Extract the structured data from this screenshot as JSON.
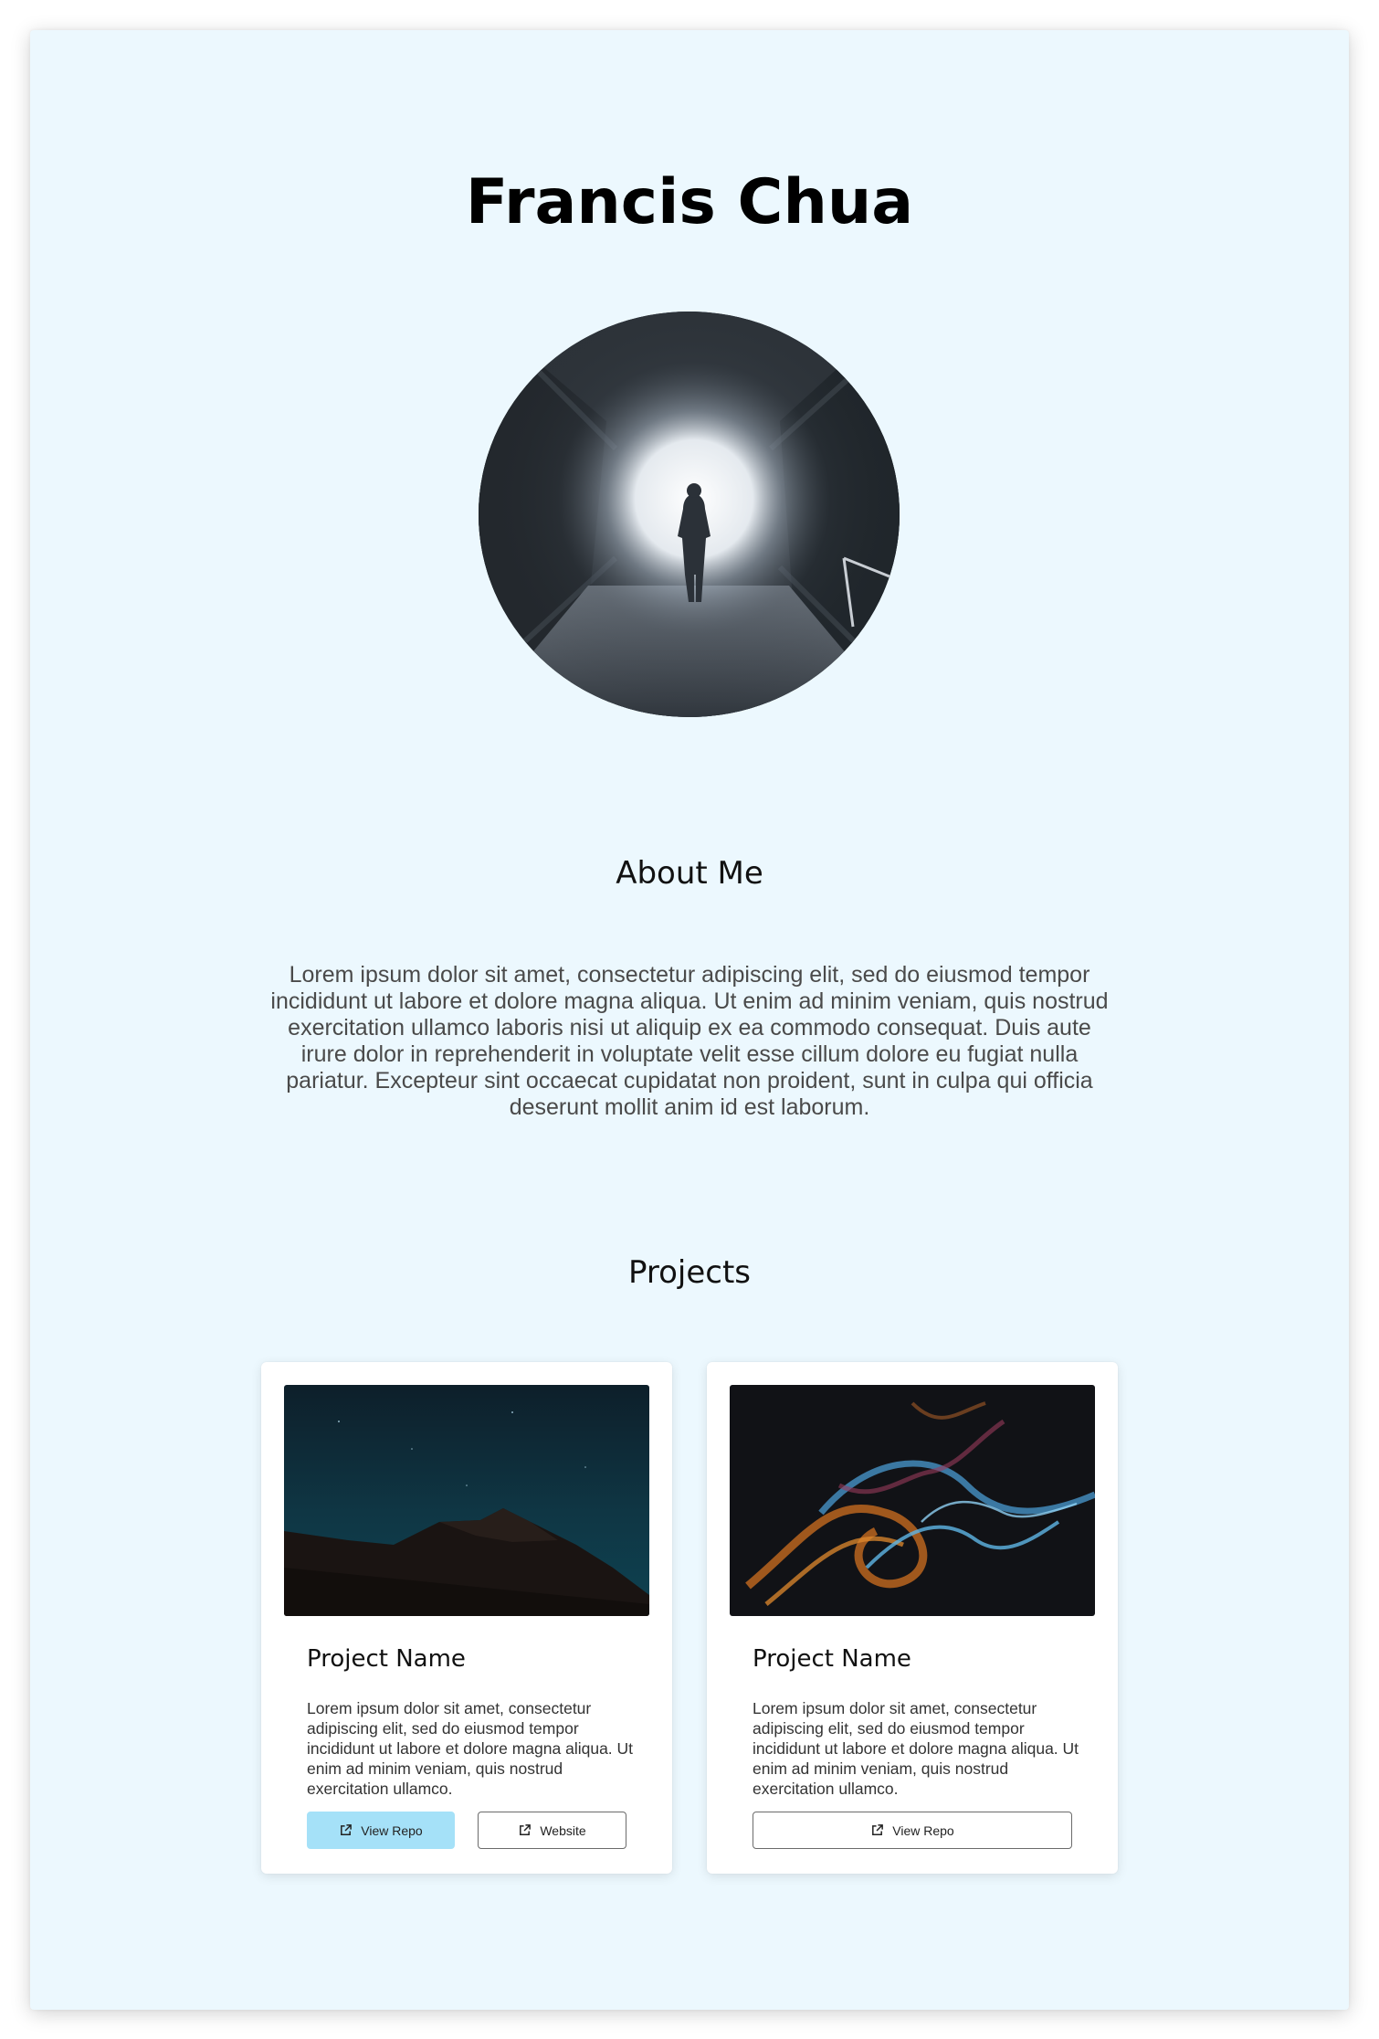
{
  "profile": {
    "name": "Francis Chua"
  },
  "about": {
    "title": "About Me",
    "text": "Lorem ipsum dolor sit amet, consectetur adipiscing elit, sed do eiusmod tempor incididunt ut labore et dolore magna aliqua. Ut enim ad minim veniam, quis nostrud exercitation ullamco laboris nisi ut aliquip ex ea commodo consequat. Duis aute irure dolor in reprehenderit in voluptate velit esse cillum dolore eu fugiat nulla pariatur. Excepteur sint occaecat cupidatat non proident, sunt in culpa qui officia deserunt mollit anim id est laborum."
  },
  "projects": {
    "title": "Projects",
    "items": [
      {
        "name": "Project Name",
        "description": "Lorem ipsum dolor sit amet, consectetur adipiscing elit, sed do eiusmod tempor incididunt ut labore et dolore magna aliqua. Ut enim ad minim veniam, quis nostrud exercitation ullamco.",
        "buttons": [
          "View Repo",
          "Website"
        ],
        "image": "night-mountain-image"
      },
      {
        "name": "Project Name",
        "description": "Lorem ipsum dolor sit amet, consectetur adipiscing elit, sed do eiusmod tempor incididunt ut labore et dolore magna aliqua. Ut enim ad minim veniam, quis nostrud exercitation ullamco.",
        "buttons": [
          "View Repo"
        ],
        "image": "colored-smoke-image"
      }
    ]
  },
  "colors": {
    "page_background": "#ecf8fe",
    "primary_button": "#a5e1f8",
    "card_background": "#ffffff"
  },
  "icons": {
    "button_icon": "external-link-icon",
    "avatar": "tunnel-photo"
  }
}
